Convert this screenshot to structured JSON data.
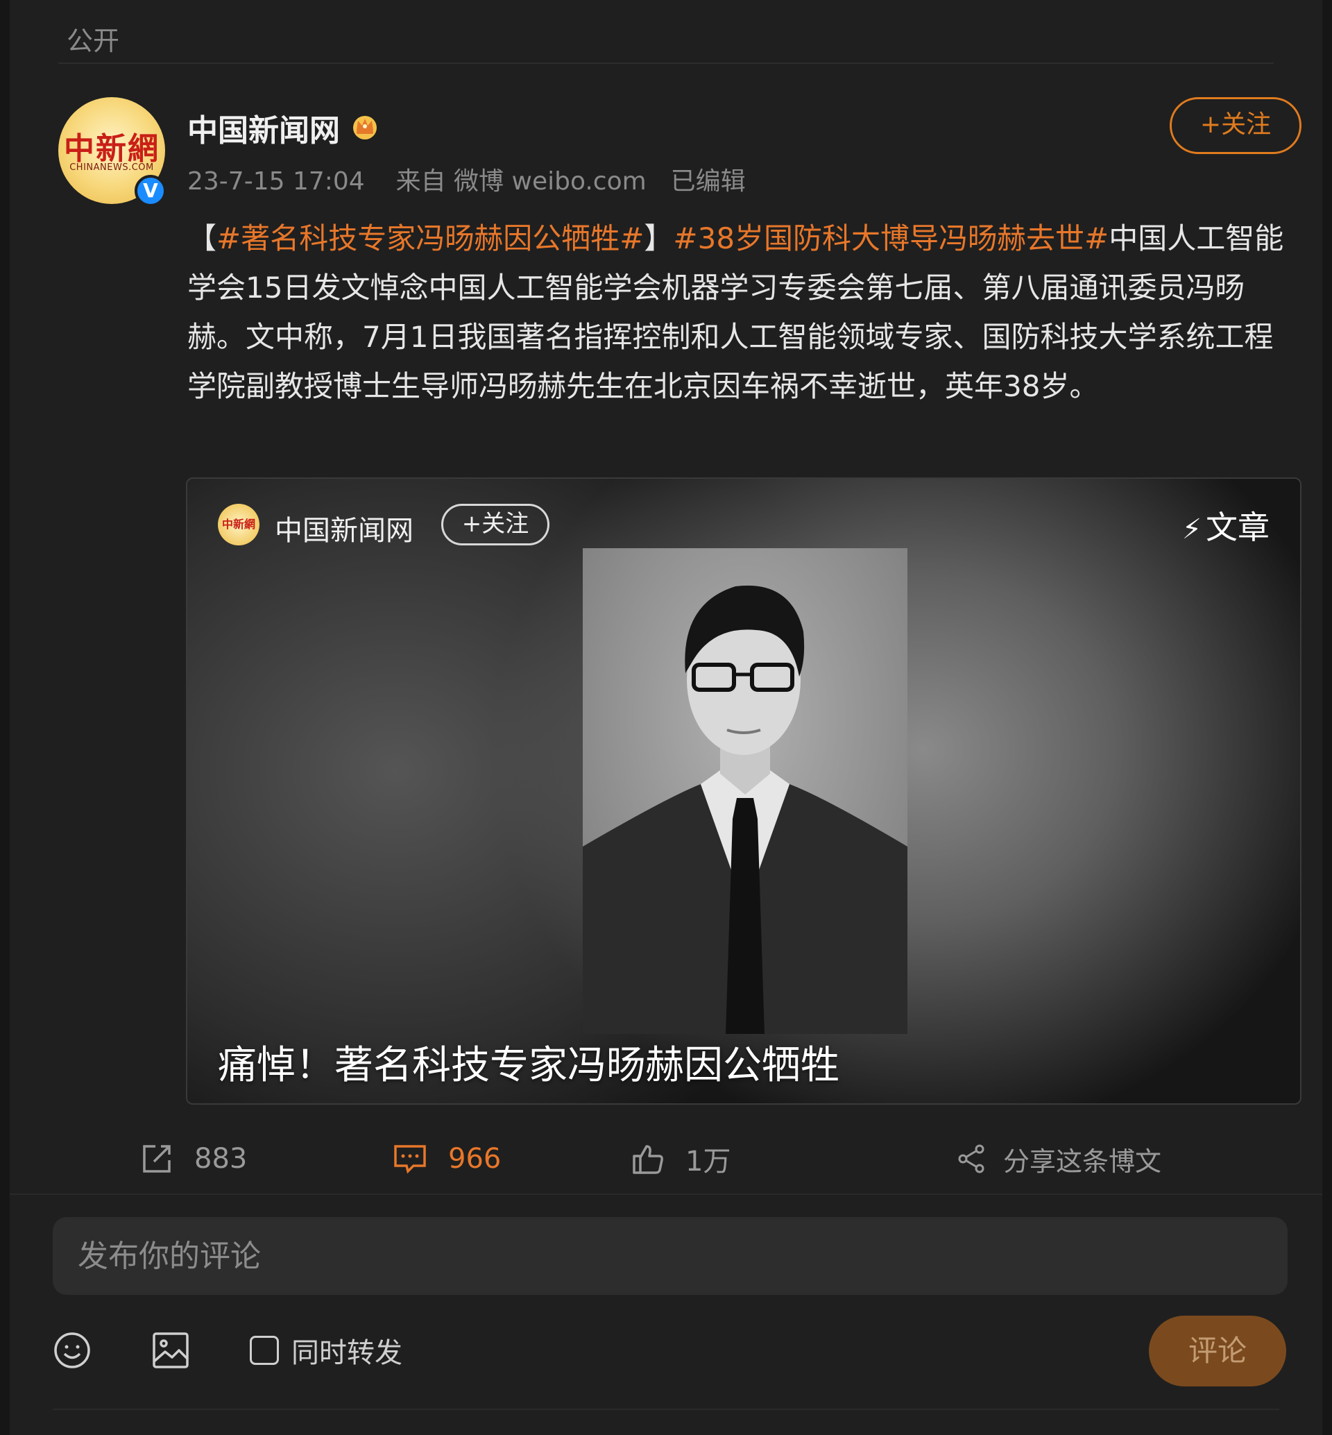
{
  "visibility": "公开",
  "author": {
    "name": "中国新闻网",
    "avatar_logo_text": "中新網",
    "avatar_logo_subtext": "CHINANEWS.COM",
    "verified_icon": "verified-v-icon",
    "badge_icon": "crown-icon"
  },
  "meta": {
    "timestamp": "23-7-15 17:04",
    "source": "来自 微博 weibo.com",
    "edited": "已编辑"
  },
  "follow_label": "+关注",
  "post": {
    "open_bracket": "【",
    "hashtag1": "#著名科技专家冯旸赫因公牺牲#",
    "close_bracket": "】",
    "hashtag2": "#38岁国防科大博导冯旸赫去世#",
    "body": "中国人工智能学会15日发文悼念中国人工智能学会机器学习专委会第七届、第八届通讯委员冯旸赫。文中称，7月1日我国著名指挥控制和人工智能领域专家、国防科技大学系统工程学院副教授博士生导师冯旸赫先生在北京因车祸不幸逝世，英年38岁。"
  },
  "article_card": {
    "author_name": "中国新闻网",
    "follow_label": "+关注",
    "type_icon": "bolt-icon",
    "type_label": "文章",
    "title": "痛悼！著名科技专家冯旸赫因公牺牲"
  },
  "actions": {
    "forward_count": "883",
    "comment_count": "966",
    "like_count": "1万",
    "share_label": "分享这条博文"
  },
  "comment_box": {
    "placeholder": "发布你的评论",
    "repost_label": "同时转发",
    "submit_label": "评论"
  },
  "colors": {
    "accent": "#e8772a",
    "background": "#1f1f1f",
    "verified": "#1a8cff"
  }
}
